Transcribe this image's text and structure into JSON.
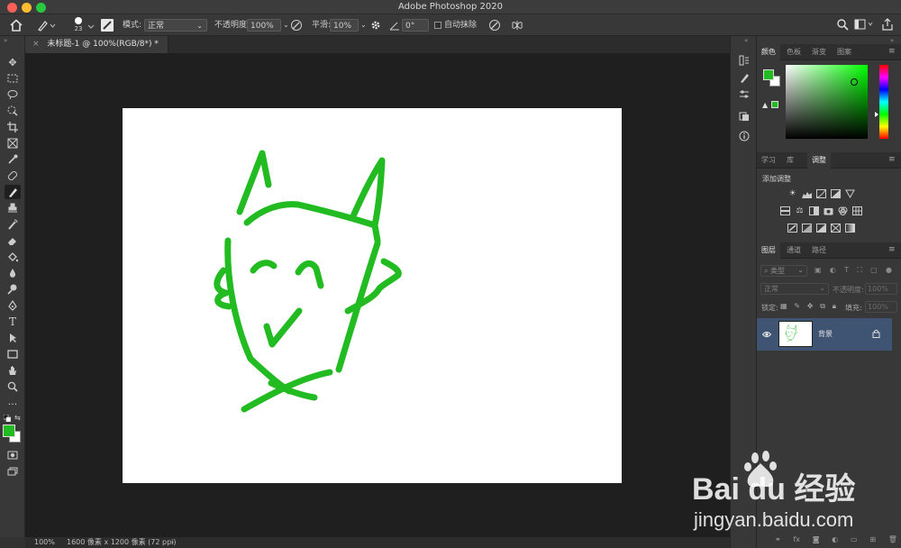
{
  "window": {
    "title": "Adobe Photoshop 2020"
  },
  "options": {
    "brush_size": "23",
    "mode_label": "模式:",
    "mode_value": "正常",
    "opacity_label": "不透明度:",
    "opacity_value": "100%",
    "smoothing_label": "平滑:",
    "smoothing_value": "10%",
    "angle_value": "0°",
    "auto_erase_label": "自动抹除"
  },
  "document": {
    "tab_title": "未标题-1 @ 100%(RGB/8*) *"
  },
  "status": {
    "zoom": "100%",
    "doc_info": "1600 像素 x 1200 像素 (72 ppi)"
  },
  "colors": {
    "foreground": "#22bb22",
    "background": "#ffffff",
    "stroke": "#22bb22"
  },
  "color_panel": {
    "tabs": [
      "颜色",
      "色板",
      "渐变",
      "图案"
    ]
  },
  "adjust_panel": {
    "tabs": [
      "学习",
      "库",
      "调整"
    ],
    "heading": "添加调整"
  },
  "layers_panel": {
    "tabs": [
      "图层",
      "通道",
      "路径"
    ],
    "filter_kind": "类型",
    "blend_mode": "正常",
    "opacity_label": "不透明度:",
    "opacity_value": "100%",
    "lock_label": "锁定:",
    "fill_label": "填充:",
    "fill_value": "100%",
    "layers": [
      {
        "name": "背景",
        "visible": true,
        "locked": true
      }
    ]
  },
  "watermark": {
    "brand": "Bai du 经验",
    "url": "jingyan.baidu.com"
  }
}
